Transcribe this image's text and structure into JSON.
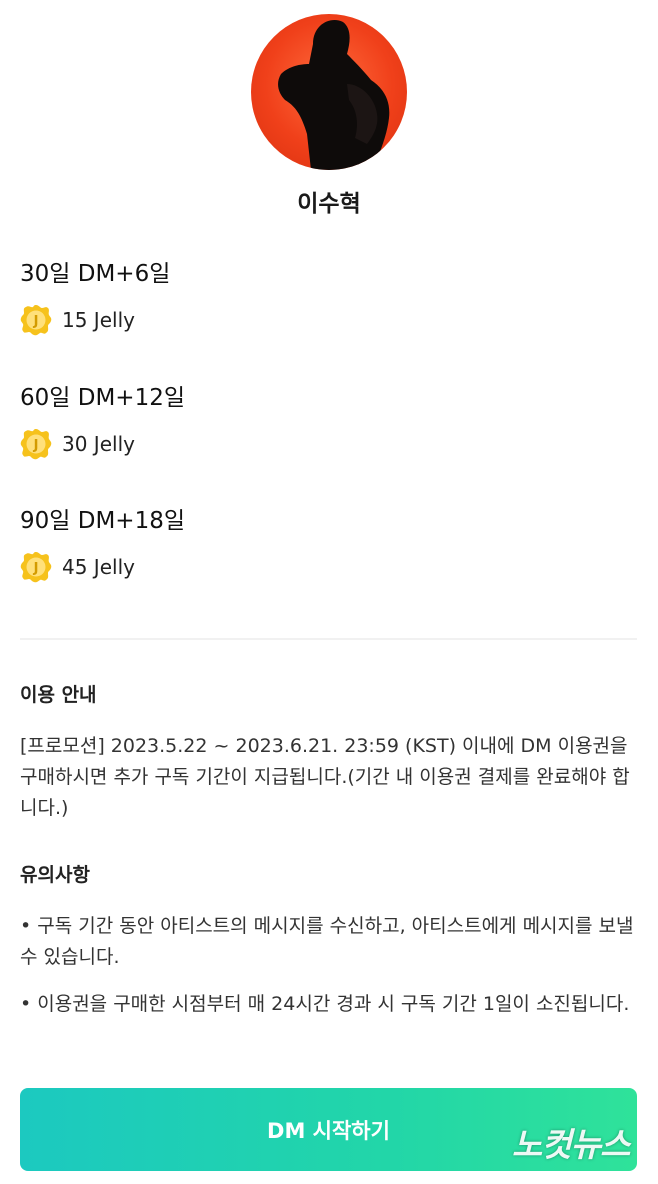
{
  "artist": {
    "name": "이수혁"
  },
  "plans": [
    {
      "title": "30일 DM+6일",
      "price": "15 Jelly"
    },
    {
      "title": "60일 DM+12일",
      "price": "30 Jelly"
    },
    {
      "title": "90일 DM+18일",
      "price": "45 Jelly"
    }
  ],
  "usage_info": {
    "title": "이용 안내",
    "body": "[프로모션] 2023.5.22 ~ 2023.6.21. 23:59 (KST) 이내에 DM 이용권을 구매하시면 추가 구독 기간이 지급됩니다.(기간 내 이용권 결제를 완료해야 합니다.)"
  },
  "notes": {
    "title": "유의사항",
    "items": [
      "• 구독 기간 동안 아티스트의 메시지를 수신하고, 아티스트에게 메시지를 보낼 수 있습니다.",
      "• 이용권을 구매한 시점부터 매 24시간 경과 시 구독 기간 1일이 소진됩니다."
    ]
  },
  "cta": {
    "label": "DM 시작하기"
  },
  "watermark": {
    "text": "노컷뉴스"
  },
  "icons": {
    "jelly": "jelly-coin-icon"
  },
  "colors": {
    "accent_start": "#1cc9c0",
    "accent_end": "#2fe29a",
    "jelly": "#f6c21c",
    "avatar_bg": "#f0401a"
  }
}
